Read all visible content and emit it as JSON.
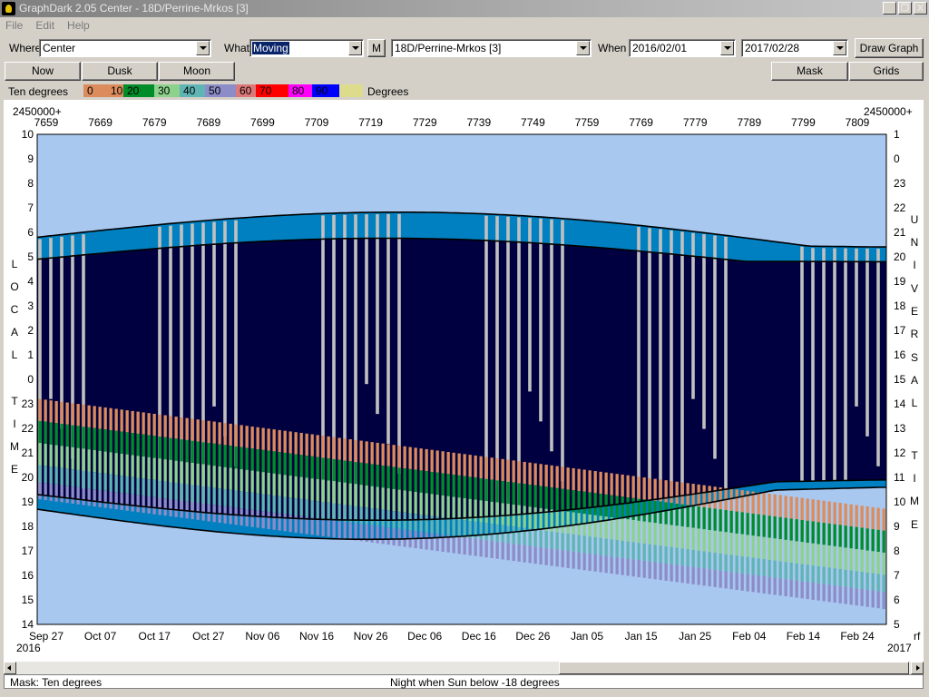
{
  "window": {
    "title": "GraphDark 2.05  Center  -  18D/Perrine-Mrkos [3]",
    "btn_min": "_",
    "btn_restore": "❐",
    "btn_close": "X"
  },
  "menu": [
    "File",
    "Edit",
    "Help"
  ],
  "toolbar": {
    "where_label": "Where",
    "where_value": "Center",
    "what_label": "What",
    "what_value": "Moving",
    "m_button": "M",
    "object_value": "18D/Perrine-Mrkos [3]",
    "when_label": "When",
    "start_date": "2016/02/01",
    "end_date": "2017/02/28",
    "draw_button": "Draw Graph"
  },
  "buttons": {
    "now": "Now",
    "dusk": "Dusk",
    "moon": "Moon",
    "mask": "Mask",
    "grids": "Grids"
  },
  "legend": {
    "title": "Ten degrees",
    "entries": [
      {
        "label": "0",
        "color": "#dc8c5c"
      },
      {
        "label": "10",
        "color": "#dc8c5c"
      },
      {
        "label": "20",
        "color": "#008c28"
      },
      {
        "label": "30",
        "color": "#8cd28c"
      },
      {
        "label": "40",
        "color": "#5fb4b4"
      },
      {
        "label": "50",
        "color": "#8c8cc8"
      },
      {
        "label": "60",
        "color": "#dc7878"
      },
      {
        "label": "70",
        "color": "#ff0000"
      },
      {
        "label": "80",
        "color": "#ff00ff"
      },
      {
        "label": "90",
        "color": "#0000ff"
      },
      {
        "label": "",
        "color": "#dcdc8c"
      }
    ],
    "unit": "Degrees"
  },
  "chart_data": {
    "type": "heatmap",
    "jd_prefix": "2450000+",
    "jd_ticks": [
      "7659",
      "7669",
      "7679",
      "7689",
      "7699",
      "7709",
      "7719",
      "7729",
      "7739",
      "7749",
      "7759",
      "7769",
      "7779",
      "7789",
      "7799",
      "7809"
    ],
    "date_ticks": [
      "Sep 27",
      "Oct 07",
      "Oct 17",
      "Oct 27",
      "Nov 06",
      "Nov 16",
      "Nov 26",
      "Dec 06",
      "Dec 16",
      "Dec 26",
      "Jan 05",
      "Jan 15",
      "Jan 25",
      "Feb 04",
      "Feb 14",
      "Feb 24"
    ],
    "year_start": "2016",
    "year_end": "2017",
    "left_axis_label": "LOCAL TIME",
    "left_ticks": [
      "10",
      "9",
      "8",
      "7",
      "6",
      "5",
      "4",
      "3",
      "2",
      "1",
      "0",
      "23",
      "22",
      "21",
      "20",
      "19",
      "18",
      "17",
      "16",
      "15",
      "14"
    ],
    "right_axis_label": "UNIVERSAL TIME",
    "right_ticks": [
      "1",
      "0",
      "23",
      "22",
      "21",
      "20",
      "19",
      "18",
      "17",
      "16",
      "15",
      "14",
      "13",
      "12",
      "11",
      "10",
      "9",
      "8",
      "7",
      "6",
      "5"
    ],
    "right_corner": "rf",
    "colors": {
      "day": "#a8c8f0",
      "night": "#000040",
      "twilight": "#0080c0",
      "moon": "#c0c0c0"
    }
  },
  "status": {
    "mask": "Mask:  Ten degrees",
    "night": "Night when Sun below -18 degrees"
  }
}
